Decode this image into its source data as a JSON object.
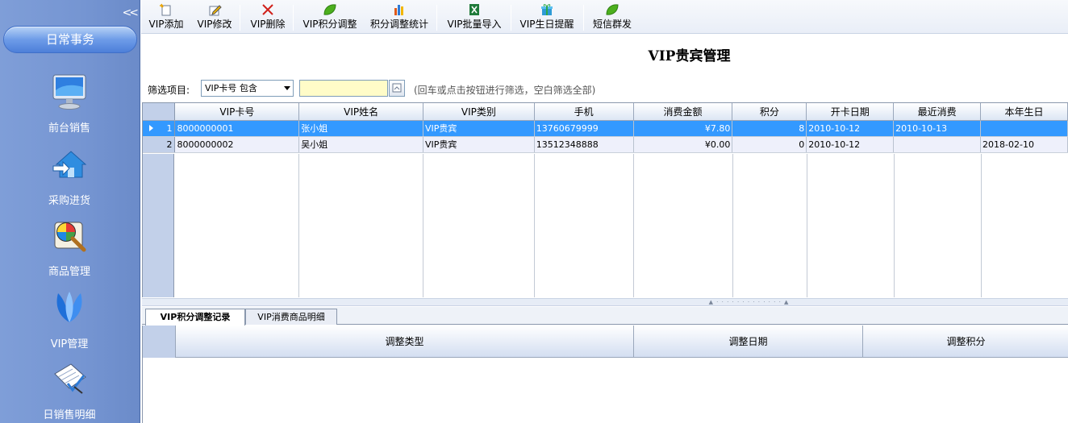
{
  "sidebar": {
    "collapse_label": "<<",
    "section_title": "日常事务",
    "items": [
      {
        "label": "前台销售",
        "icon": "monitor-icon"
      },
      {
        "label": "采购进货",
        "icon": "house-import-icon"
      },
      {
        "label": "商品管理",
        "icon": "palette-magnifier-icon"
      },
      {
        "label": "VIP管理",
        "icon": "vip-flower-icon"
      },
      {
        "label": "日销售明细",
        "icon": "report-check-icon"
      }
    ]
  },
  "toolbar": {
    "buttons": [
      {
        "label": "VIP添加",
        "icon": "add-document-icon"
      },
      {
        "label": "VIP修改",
        "icon": "edit-document-icon"
      },
      {
        "label": "VIP删除",
        "icon": "delete-x-icon"
      },
      {
        "label": "VIP积分调整",
        "icon": "leaf-icon"
      },
      {
        "label": "积分调整统计",
        "icon": "bar-chart-icon"
      },
      {
        "label": "VIP批量导入",
        "icon": "excel-icon"
      },
      {
        "label": "VIP生日提醒",
        "icon": "gift-icon"
      },
      {
        "label": "短信群发",
        "icon": "leaf-icon"
      }
    ]
  },
  "main": {
    "title": "VIP贵宾管理",
    "filter": {
      "label": "筛选项目:",
      "selected": "VIP卡号 包含",
      "value": "",
      "hint": "(回车或点击按钮进行筛选，空白筛选全部)"
    },
    "grid": {
      "columns": [
        "VIP卡号",
        "VIP姓名",
        "VIP类别",
        "手机",
        "消费金额",
        "积分",
        "开卡日期",
        "最近消费",
        "本年生日"
      ],
      "rows": [
        {
          "index": "1",
          "card": "8000000001",
          "name": "张小姐",
          "type": "VIP贵宾",
          "phone": "13760679999",
          "amount": "¥7.80",
          "points": "8",
          "open_date": "2010-10-12",
          "last": "2010-10-13",
          "birthday": ""
        },
        {
          "index": "2",
          "card": "8000000002",
          "name": "吴小姐",
          "type": "VIP贵宾",
          "phone": "13512348888",
          "amount": "¥0.00",
          "points": "0",
          "open_date": "2010-10-12",
          "last": "",
          "birthday": "2018-02-10"
        }
      ]
    },
    "tabs": [
      "VIP积分调整记录",
      "VIP消费商品明细"
    ],
    "subgrid": {
      "columns": [
        "调整类型",
        "调整日期",
        "调整积分"
      ]
    }
  },
  "colors": {
    "sidebar": "#7595d2",
    "selection": "#3399ff",
    "filter_input_bg": "#fffcc8"
  }
}
